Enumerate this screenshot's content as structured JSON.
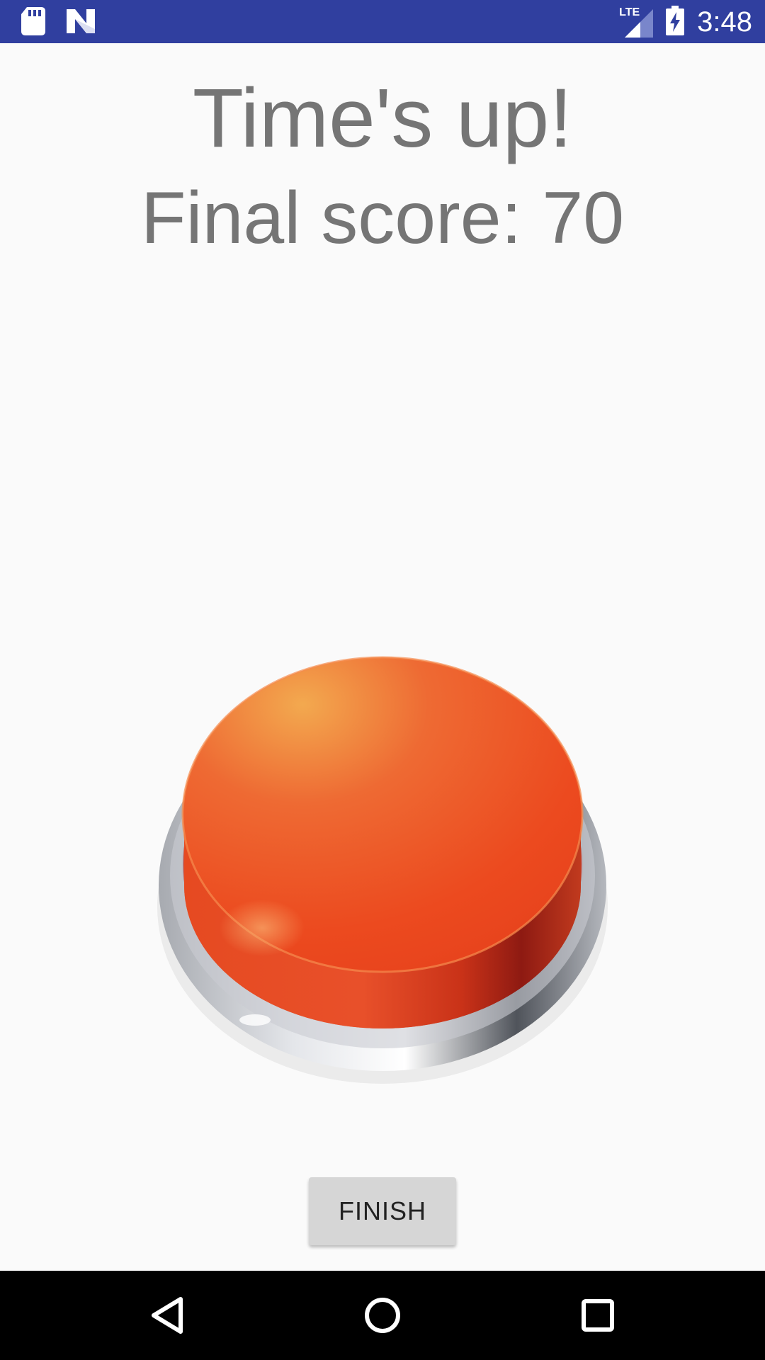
{
  "status_bar": {
    "time": "3:48",
    "network_label": "LTE",
    "icons": [
      "sd-card-icon",
      "n-notification-icon",
      "signal-icon",
      "battery-charging-icon"
    ],
    "background_color": "#303f9f"
  },
  "screen": {
    "title": "Time's up!",
    "score_text": "Final score: 70",
    "text_color": "#757575",
    "background_color": "#fafafa"
  },
  "big_button": {
    "icon": "red-push-button-icon",
    "color": "#ee4b1f"
  },
  "finish_button": {
    "label": "FINISH"
  },
  "nav_bar": {
    "icons": [
      "back-icon",
      "home-icon",
      "recents-icon"
    ],
    "background_color": "#000000"
  }
}
